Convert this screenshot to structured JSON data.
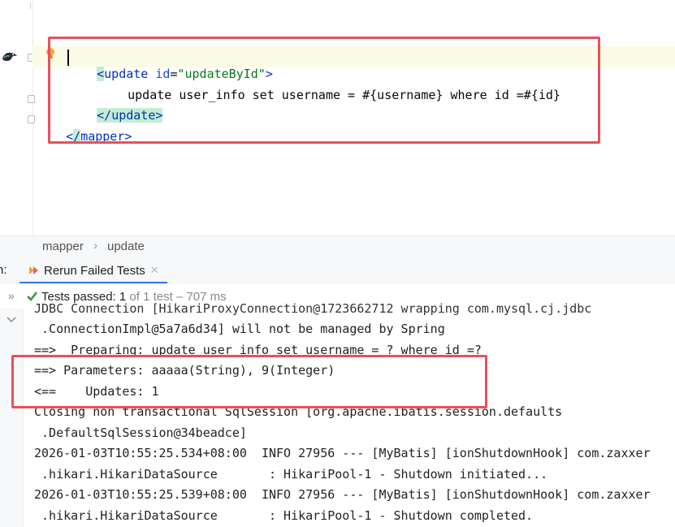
{
  "editor": {
    "lines": [
      {
        "tag_open": "update",
        "attr": "id",
        "value": "\"updateById\""
      },
      {
        "sql": "update user_info set username = #{username} where id =#{id}"
      },
      {
        "tag_close": "update"
      },
      {
        "mapper_close_prefix": "<",
        "mapper_close_hl": "/",
        "mapper_close_name": "mapper",
        "mapper_close_suffix": ">"
      }
    ]
  },
  "breadcrumb": {
    "items": [
      "mapper",
      "update"
    ],
    "separator": "›"
  },
  "run_panel": {
    "left_label": "n:",
    "tab_label": "Rerun Failed Tests",
    "status_prefix": "Tests passed: ",
    "passed": "1",
    "status_suffix": " of 1 test – 707 ms"
  },
  "console": {
    "lines": [
      "JDBC Connection [HikariProxyConnection@1723662712 wrapping com.mysql.cj.jdbc",
      " .ConnectionImpl@5a7a6d34] will not be managed by Spring",
      "==>  Preparing: update user_info set username = ? where id =?",
      "==> Parameters: aaaaa(String), 9(Integer)",
      "<==    Updates: 1",
      "Closing non transactional SqlSession [org.apache.ibatis.session.defaults",
      " .DefaultSqlSession@34beadce]",
      "2026-01-03T10:55:25.534+08:00  INFO 27956 --- [MyBatis] [ionShutdownHook] com.zaxxer",
      " .hikari.HikariDataSource       : HikariPool-1 - Shutdown initiated...",
      "2026-01-03T10:55:25.539+08:00  INFO 27956 --- [MyBatis] [ionShutdownHook] com.zaxxer",
      " .hikari.HikariDataSource       : HikariPool-1 - Shutdown completed."
    ]
  },
  "colors": {
    "highlight_box": "#e8505b",
    "tag": "#0033b3",
    "string": "#067d17",
    "pass": "#3d9a3d",
    "tab_underline": "#3574f0"
  },
  "icons": [
    "mybatis-bird-icon",
    "bulb-icon",
    "fold-icon",
    "rerun-icon",
    "close-icon",
    "check-icon",
    "expand-icon",
    "chevron-down-icon"
  ]
}
